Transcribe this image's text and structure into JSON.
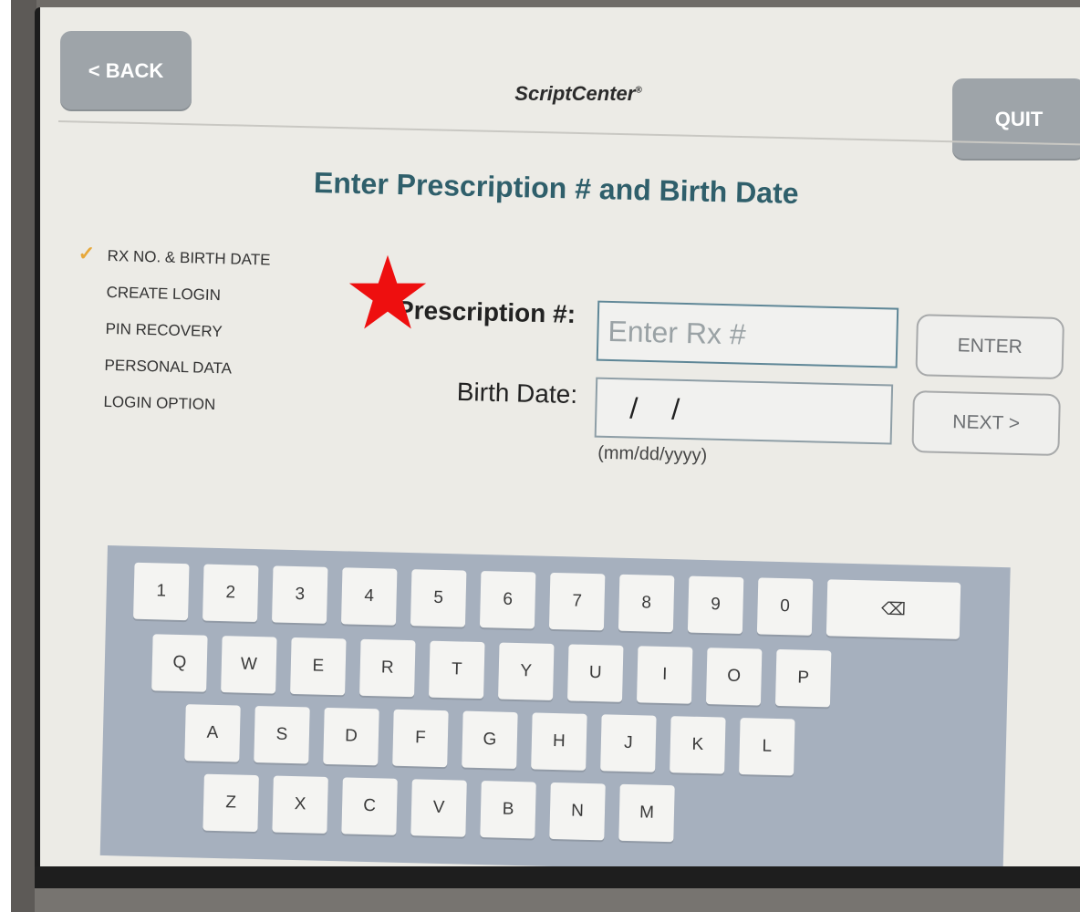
{
  "header": {
    "back_label": "< BACK",
    "app_title": "ScriptCenter",
    "app_title_mark": "®",
    "quit_label": "QUIT"
  },
  "page": {
    "heading": "Enter Prescription # and Birth Date"
  },
  "steps": [
    {
      "label": "RX NO. & BIRTH DATE",
      "completed": true
    },
    {
      "label": "CREATE LOGIN",
      "completed": false
    },
    {
      "label": "PIN RECOVERY",
      "completed": false
    },
    {
      "label": "PERSONAL DATA",
      "completed": false
    },
    {
      "label": "LOGIN OPTION",
      "completed": false
    }
  ],
  "form": {
    "rx_label": "Prescription #:",
    "rx_placeholder": "Enter Rx #",
    "rx_value": "",
    "birth_label": "Birth Date:",
    "birth_value": "/ /",
    "birth_hint": "(mm/dd/yyyy)",
    "enter_label": "ENTER",
    "next_label": "NEXT >"
  },
  "keyboard": {
    "row1": [
      "1",
      "2",
      "3",
      "4",
      "5",
      "6",
      "7",
      "8",
      "9",
      "0"
    ],
    "row2": [
      "Q",
      "W",
      "E",
      "R",
      "T",
      "Y",
      "U",
      "I",
      "O",
      "P"
    ],
    "row3": [
      "A",
      "S",
      "D",
      "F",
      "G",
      "H",
      "J",
      "K",
      "L"
    ],
    "row4": [
      "Z",
      "X",
      "C",
      "V",
      "B",
      "N",
      "M"
    ],
    "backspace_icon": "backspace-icon"
  },
  "colors": {
    "heading": "#2f5f6b",
    "check": "#e7a83a",
    "star": "#ee0f0f",
    "keyboard_bg": "#a6b0be",
    "header_button": "#9ea4a9"
  }
}
